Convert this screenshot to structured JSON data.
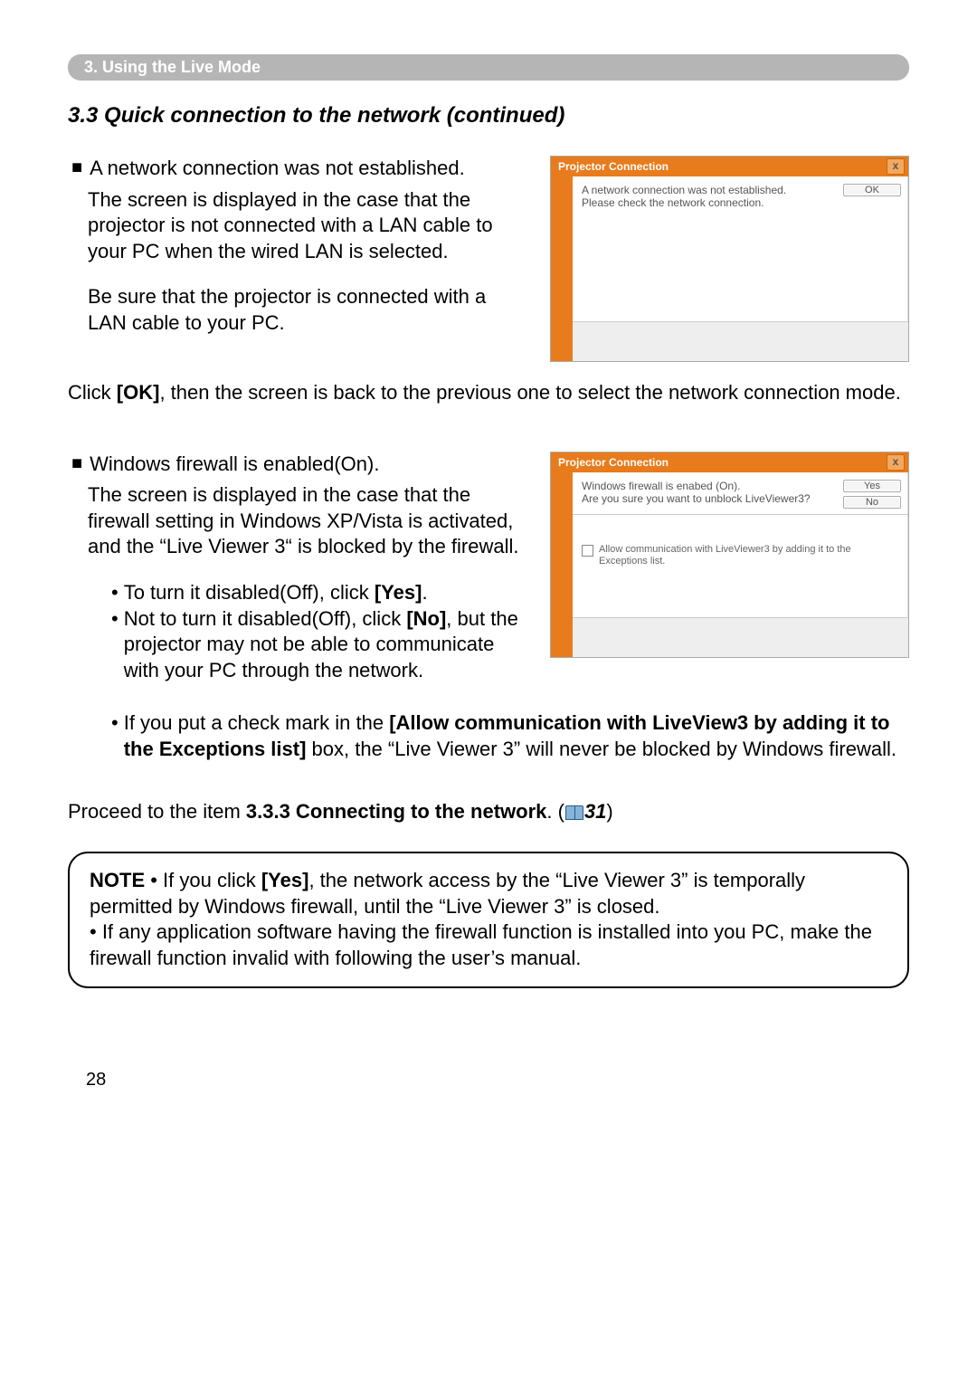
{
  "header": {
    "section": "3. Using the Live Mode"
  },
  "subsection": "3.3 Quick connection to the network (continued)",
  "block1": {
    "heading": "A network connection was not established.",
    "p1": "The screen is displayed in the case that the projector is not connected with a LAN cable to your PC when the wired LAN is selected.",
    "p2": "Be sure that the projector is connected with a LAN cable to your PC.",
    "after": "Click [OK], then the screen is back to the previous one to select the network connection mode."
  },
  "dialog1": {
    "title": "Projector Connection",
    "line1": "A network connection was not established.",
    "line2": "Please check the network connection.",
    "ok": "OK"
  },
  "block2": {
    "heading": "Windows firewall is enabled(On).",
    "p1": "The screen is displayed in the case that the firewall setting in Windows XP/Vista is activated, and the “Live Viewer 3“ is blocked by the firewall.",
    "b1a": "To turn it disabled(Off), click ",
    "b1b": "[Yes]",
    "b1c": ".",
    "b2a": "Not to turn it disabled(Off), click ",
    "b2b": "[No]",
    "b2c": ", but the projector may not be able to communicate with your PC through the network.",
    "b3a": "If you put a check mark in the ",
    "b3b": "[Allow communication with LiveView3 by adding it to the Exceptions list]",
    "b3c": " box, the “Live Viewer 3” will never be blocked by Windows firewall."
  },
  "dialog2": {
    "title": "Projector Connection",
    "line1": "Windows firewall is enabed (On).",
    "line2": "Are you sure you want to unblock LiveViewer3?",
    "chk": "Allow communication with LiveViewer3 by adding it to the Exceptions list.",
    "yes": "Yes",
    "no": "No"
  },
  "proceed": {
    "a": "Proceed to the item ",
    "b": "3.3.3 Connecting to the network",
    "c": ". (",
    "ref": "31",
    "d": ")"
  },
  "note": {
    "label": "NOTE",
    "t1": "  • If you click ",
    "t2": "[Yes]",
    "t3": ", the network access by the “Live Viewer 3” is temporally permitted by Windows firewall, until the “Live Viewer 3” is closed.",
    "t4": "• If any application software having the firewall function is installed into you PC, make the firewall function invalid with following the user’s manual."
  },
  "page_number": "28"
}
